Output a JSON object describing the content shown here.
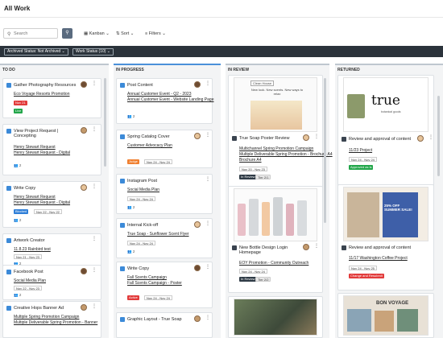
{
  "header": {
    "title": "All Work"
  },
  "toolbar": {
    "search_placeholder": "Search",
    "kanban_label": "Kanban",
    "sort_label": "Sort",
    "filters_label": "Filters"
  },
  "filters": {
    "archived": "Archived Status: Not Archived",
    "work_status": "Work Status (10)"
  },
  "columns": {
    "todo": {
      "label": "TO DO"
    },
    "in_progress": {
      "label": "IN PROGRESS"
    },
    "in_review": {
      "label": "IN REVIEW"
    },
    "returned": {
      "label": "RETURNED"
    }
  },
  "cards": {
    "todo": [
      {
        "title": "Gather Photography Resources",
        "link1": "Eco Voyage Resorts Promotion",
        "date": "Nov 21",
        "status": "Live",
        "people": "2"
      },
      {
        "title": "View Project Request | Concepting",
        "link1": "Henry Stewart Request",
        "link2": "Henry Stewart Request - Digital",
        "people": "2"
      },
      {
        "title": "Write Copy",
        "link1": "Henry Stewart Request",
        "link2": "Henry Stewart Request - Digital",
        "status": "Blocked",
        "date": "Nov 22 - Nov 22",
        "people": "2"
      },
      {
        "title": "Artwork Creator",
        "link1": "11.8.23 Rainbird test",
        "date": "Nov 21 - Nov 23",
        "people": "2"
      },
      {
        "title": "Facebook Post",
        "link1": "Social Media Plan",
        "date": "Nov 22 - Nov 23",
        "people": "2"
      },
      {
        "title": "Creative Hops Banner Ad",
        "link1": "Multiple Spring Promotion Campaign",
        "link2": "Multiple Deliverable Spring Promotion - Banner"
      }
    ],
    "in_progress": [
      {
        "title": "Post Content",
        "link1": "Annual Customer Event - Q2 - 2023",
        "link2": "Annual Customer Event - Website Landing Page",
        "people": "2"
      },
      {
        "title": "Spring Catalog Cover",
        "link1": "Customer Advocacy Plan",
        "status": "Judge",
        "date": "Nov 24 - Nov 24"
      },
      {
        "title": "Instagram Post",
        "link1": "Social Media Plan",
        "date": "Nov 24 - Nov 24",
        "people": "2"
      },
      {
        "title": "Internal Kick-off",
        "link1": "True Soap - Sunflower Scent Flyer",
        "date": "Nov 24 - Nov 24",
        "people": "2"
      },
      {
        "title": "Write Copy",
        "link1": "Fall Scents Campaign",
        "link2": "Fall Scents Campaign - Poster",
        "status": "Active",
        "date": "Nov 24 - Nov 24"
      },
      {
        "title": "Graphic Layout - True Soap"
      }
    ],
    "in_review": [
      {
        "title": "True Soap Poster Review",
        "link1": "Multichannel Spring Promotion Campaign",
        "link2": "Multiple Deliverable Spring Promotion - Brochure A4",
        "date": "Nov 20 - Nov 23",
        "status": "In Review",
        "tier": "Tier 2/1"
      },
      {
        "title": "New Bottle Design Login Homepage",
        "link1": "EOY Promotion - Community Outreach",
        "date": "Nov 24 - Nov 24",
        "status": "In Review",
        "tier": "Tier 2/2"
      },
      {
        "title": ""
      }
    ],
    "returned": [
      {
        "title": "Review and approval of content",
        "link1": "11/23 Project",
        "date": "Nov 24 - Nov 24",
        "status": "Approved as is"
      },
      {
        "title": "Review and approval of content",
        "link1": "11/17 Washington Coffee Project",
        "date": "Nov 24 - Nov 25",
        "status": "Change and Resubmit"
      }
    ]
  },
  "thumbs": {
    "soap_heading": "Clean House",
    "soap_text": "New look. New scents. New ways to relax",
    "true_brand": "true",
    "true_sub": "botanical goods",
    "book_text": "25% OFF SUMMER SALE!",
    "bon_text": "BON VOYAGE"
  },
  "colors": {
    "accent": "#4a90d9",
    "dark": "#2b333b"
  }
}
